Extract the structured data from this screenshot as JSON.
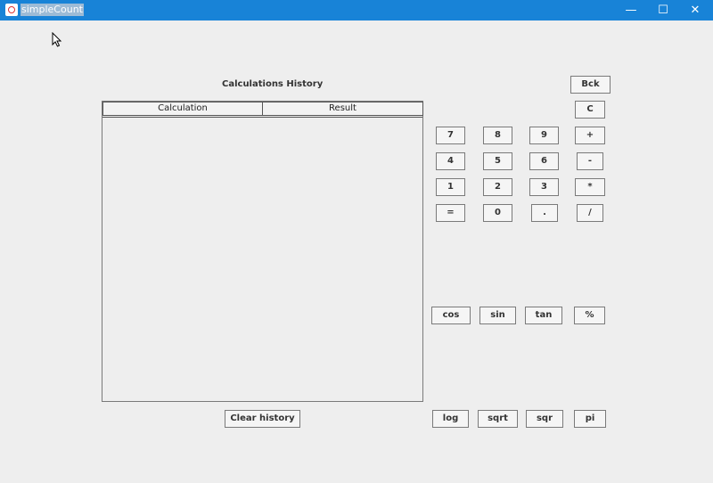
{
  "window": {
    "title": "simpleCount",
    "minimize_label": "—",
    "maximize_label": "☐",
    "close_label": "✕"
  },
  "history": {
    "title": "Calculations History",
    "columns": [
      "Calculation",
      "Result"
    ],
    "clear_label": "Clear history"
  },
  "keys": {
    "bck": "Bck",
    "c": "C",
    "k7": "7",
    "k8": "8",
    "k9": "9",
    "plus": "+",
    "k4": "4",
    "k5": "5",
    "k6": "6",
    "minus": "-",
    "k1": "1",
    "k2": "2",
    "k3": "3",
    "mul": "*",
    "eq": "=",
    "k0": "0",
    "dot": ".",
    "div": "/",
    "cos": "cos",
    "sin": "sin",
    "tan": "tan",
    "pct": "%",
    "log": "log",
    "sqrt": "sqrt",
    "sqr": "sqr",
    "pi": "pi"
  }
}
